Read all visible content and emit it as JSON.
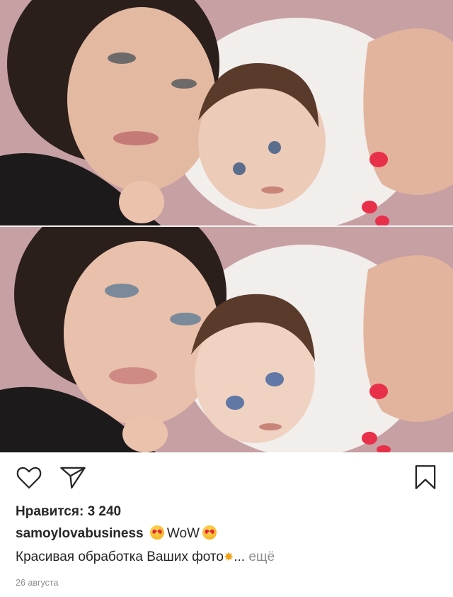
{
  "post": {
    "images": [
      {
        "label": "photo-before"
      },
      {
        "label": "photo-after"
      }
    ],
    "actions": {
      "like_icon": "heart-icon",
      "share_icon": "paper-plane-icon",
      "save_icon": "bookmark-icon"
    },
    "likes_text": "Нравится: 3 240",
    "caption": {
      "username": "samoylovabusiness",
      "text": "WoW",
      "emoji": "heart-eyes-emoji"
    },
    "description": {
      "text": "Красивая обработка Ваших фото",
      "emoji": "sparkle-emoji",
      "ellipsis": "...",
      "more": "ещё"
    },
    "date": "26 августа"
  }
}
